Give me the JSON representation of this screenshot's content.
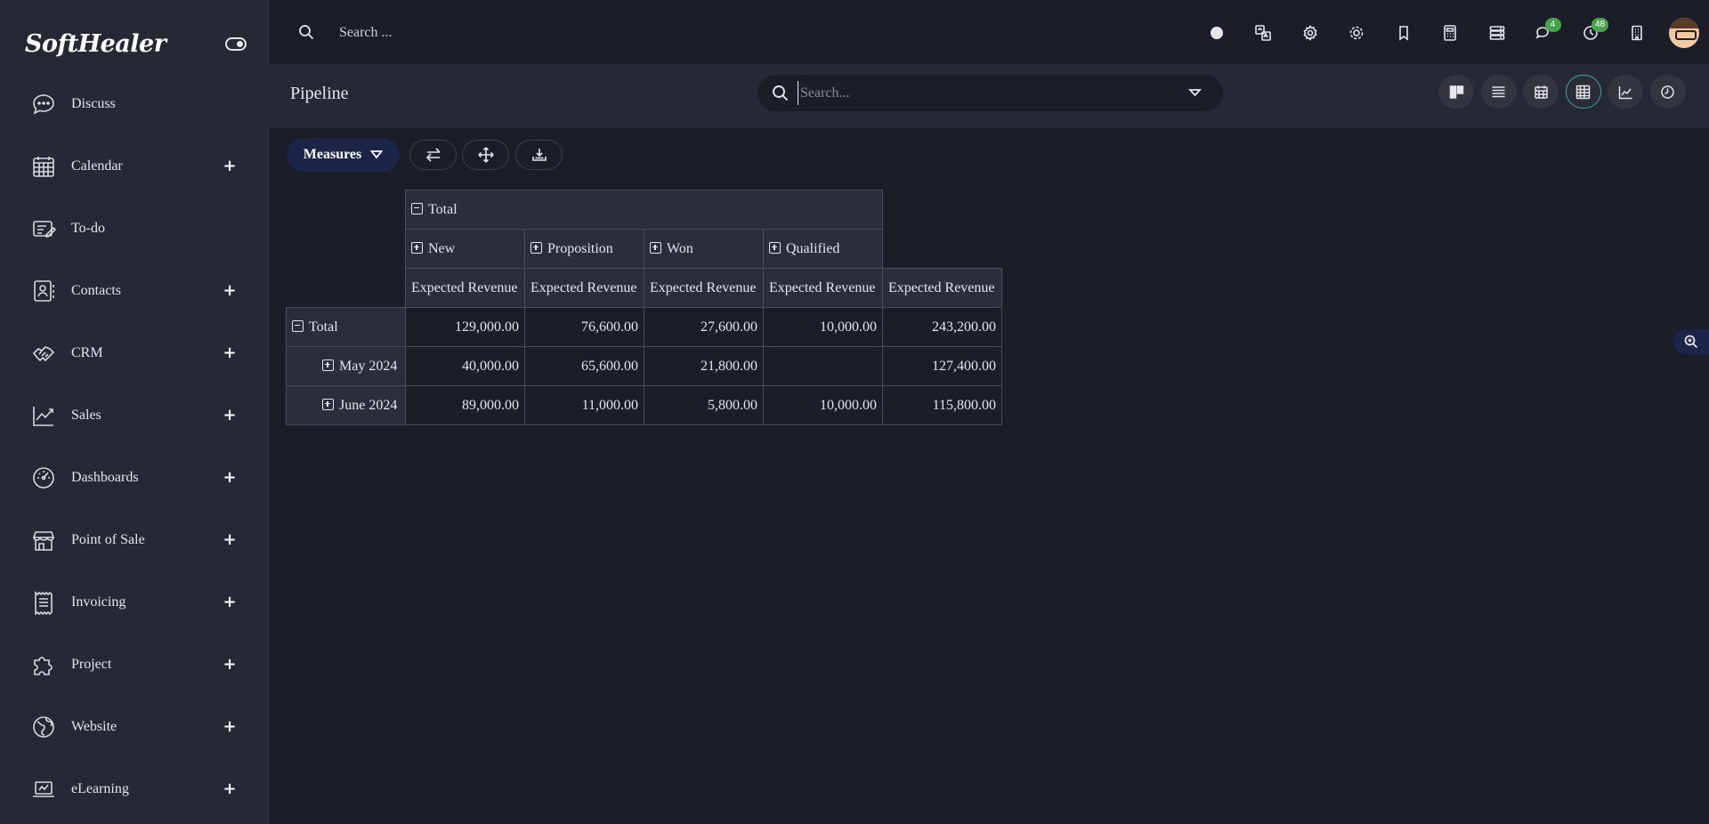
{
  "brand": {
    "name": "SoftHealer"
  },
  "sidebar": {
    "items": [
      {
        "label": "Discuss",
        "icon": "chat-bubble-icon",
        "expandable": false
      },
      {
        "label": "Calendar",
        "icon": "calendar-icon",
        "expandable": true
      },
      {
        "label": "To-do",
        "icon": "note-pencil-icon",
        "expandable": false
      },
      {
        "label": "Contacts",
        "icon": "contact-card-icon",
        "expandable": true
      },
      {
        "label": "CRM",
        "icon": "handshake-icon",
        "expandable": true
      },
      {
        "label": "Sales",
        "icon": "trend-chart-icon",
        "expandable": true
      },
      {
        "label": "Dashboards",
        "icon": "gauge-icon",
        "expandable": true
      },
      {
        "label": "Point of Sale",
        "icon": "store-icon",
        "expandable": true
      },
      {
        "label": "Invoicing",
        "icon": "receipt-icon",
        "expandable": true
      },
      {
        "label": "Project",
        "icon": "puzzle-icon",
        "expandable": true
      },
      {
        "label": "Website",
        "icon": "globe-icon",
        "expandable": true
      },
      {
        "label": "eLearning",
        "icon": "laptop-icon",
        "expandable": true
      }
    ],
    "plus_label": "+"
  },
  "topbar": {
    "search_placeholder": "Search ...",
    "icons": [
      {
        "name": "status-dot-icon"
      },
      {
        "name": "translate-icon"
      },
      {
        "name": "settings-gear-icon"
      },
      {
        "name": "cog-icon"
      },
      {
        "name": "bookmark-icon"
      },
      {
        "name": "calculator-icon"
      },
      {
        "name": "server-list-icon"
      },
      {
        "name": "messages-icon",
        "badge": "4"
      },
      {
        "name": "activity-clock-icon",
        "badge": "48"
      },
      {
        "name": "building-icon"
      }
    ],
    "badge_color": "#47a447"
  },
  "control_panel": {
    "title": "Pipeline",
    "search_placeholder": "Search...",
    "views": [
      "kanban-view-icon",
      "list-view-icon",
      "calendar-view-icon",
      "pivot-view-icon",
      "graph-view-icon",
      "activity-view-icon"
    ],
    "active_view": "pivot-view-icon",
    "active_color": "#3ea6a0"
  },
  "toolbar": {
    "measures_label": "Measures",
    "buttons": [
      "flip-axis-icon",
      "expand-all-icon",
      "download-icon"
    ]
  },
  "pivot": {
    "col_total_label": "Total",
    "col_groups": [
      "New",
      "Proposition",
      "Won",
      "Qualified"
    ],
    "measure_label": "Expected Revenue",
    "rows": [
      {
        "label": "Total",
        "expanded": true,
        "values": [
          "129,000.00",
          "76,600.00",
          "27,600.00",
          "10,000.00",
          "243,200.00"
        ]
      },
      {
        "label": "May 2024",
        "expanded": false,
        "values": [
          "40,000.00",
          "65,600.00",
          "21,800.00",
          "",
          "127,400.00"
        ]
      },
      {
        "label": "June 2024",
        "expanded": false,
        "values": [
          "89,000.00",
          "11,000.00",
          "5,800.00",
          "10,000.00",
          "115,800.00"
        ]
      }
    ]
  }
}
